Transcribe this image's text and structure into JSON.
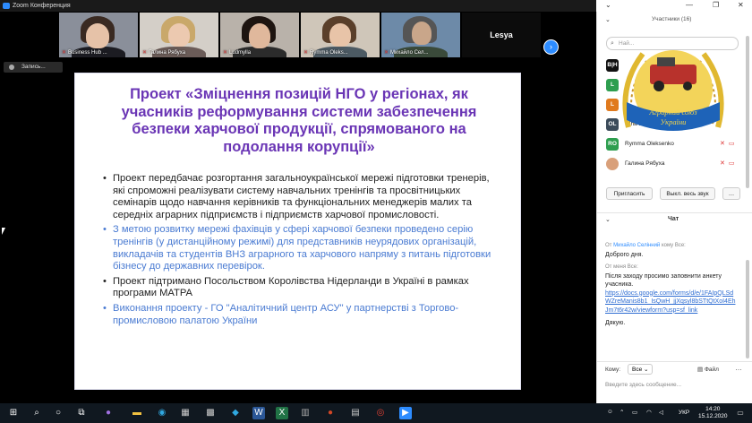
{
  "window": {
    "title": "Zoom Конференция"
  },
  "gallery": {
    "tiles": [
      {
        "name": "Business Hub ..."
      },
      {
        "name": "Галина Рябуха"
      },
      {
        "name": "Ludmylla"
      },
      {
        "name": "Rymma Oleks..."
      },
      {
        "name": "Михайло Сел..."
      },
      {
        "name": "Lesya"
      }
    ]
  },
  "record": {
    "label": "Запись..."
  },
  "slide": {
    "title": "Проект «Зміцнення позицій НГО у регіонах, як учасників реформування системи забезпечення безпеки харчової продукції, спрямованого на подолання корупції»",
    "bullets": [
      {
        "text": "Проект передбачає розгортання загальноукраїнської мережі підготовки тренерів, які спроможні реалізувати систему навчальних тренінгів та просвітницьких семінарів щодо навчання керівників та функціональних менеджерів малих та середніх аграрних підприємств і підприємств харчової промисловості.",
        "blue": false
      },
      {
        "text": "З метою розвитку мережі фахівців у сфері харчової безпеки проведено серію тренінгів (у дистанційному режимі) для представників неурядових організацій, викладачів та студентів ВНЗ аграрного та харчового напряму з питань підготовки бізнесу до державних перевірок.",
        "blue": true
      },
      {
        "text": "Проект підтримано Посольством Королівства Нідерланди в Україні в рамках програми МАТРА",
        "blue": false
      },
      {
        "text": "Виконання проекту -  ГО \"Аналітичний центр АСУ\" у партнерстві з Торгово-промисловою палатою України",
        "blue": true
      }
    ]
  },
  "participants": {
    "header": "Участники (16)",
    "search_placeholder": "Най...",
    "list": [
      {
        "initials": "B|H",
        "name": "",
        "color": "#111111"
      },
      {
        "initials": "L",
        "name": "",
        "color": "#2e9e4f"
      },
      {
        "initials": "L",
        "name": "",
        "color": "#e07a1e"
      },
      {
        "initials": "OL",
        "name": "Olha L...",
        "color": "#3b4b5a"
      },
      {
        "initials": "RO",
        "name": "Rymma Oleksenko",
        "color": "#2e9e4f"
      },
      {
        "initials": "",
        "name": "Галина Рябуха",
        "color": "#d9a07a"
      }
    ],
    "invite_label": "Пригласить",
    "mute_all_label": "Выкл. весь звук"
  },
  "logo": {
    "text_line1": "Аграрний союз",
    "text_line2": "України"
  },
  "chat": {
    "header": "Чат",
    "messages": [
      {
        "from_prefix": "От",
        "from": "Михайло Селінний",
        "to": "кому Все:",
        "text": "Доброго дня.",
        "link": ""
      },
      {
        "from_prefix": "От",
        "from": "меня",
        "to": "Все:",
        "text": "Після заходу просимо заповнити анкету учасника.",
        "link": "https://docs.google.com/forms/d/e/1FAIpQLSdWZreManis8b1_IsQwH_jjXqsyl8bSTtQtXoI4EhJm7t6r42w/viewform?usp=sf_link"
      }
    ],
    "tail": "Дякую.",
    "to_label": "Кому:",
    "to_value": "Все",
    "file_label": "Файл",
    "input_placeholder": "Введите здесь сообщение..."
  },
  "taskbar": {
    "lang": "УКР",
    "time": "14:20",
    "date": "15.12.2020"
  }
}
